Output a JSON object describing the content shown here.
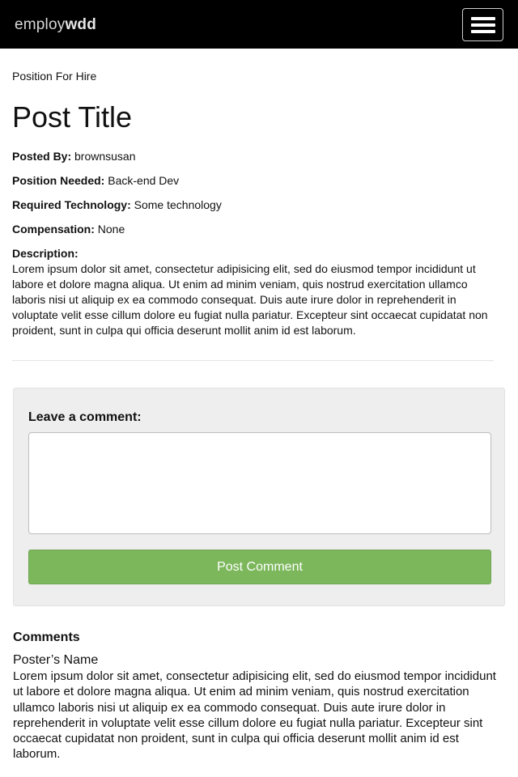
{
  "navbar": {
    "brand_light": "employ",
    "brand_bold": "wdd",
    "menu_icon": "hamburger-menu-icon"
  },
  "post": {
    "category": "Position For Hire",
    "title": "Post Title",
    "fields": [
      {
        "label": "Posted By:",
        "value": "brownsusan"
      },
      {
        "label": "Position Needed:",
        "value": "Back-end Dev"
      },
      {
        "label": "Required Technology:",
        "value": "Some technology"
      },
      {
        "label": "Compensation:",
        "value": "None"
      }
    ],
    "description_label": "Description:",
    "description": "Lorem ipsum dolor sit amet, consectetur adipisicing elit, sed do eiusmod tempor incididunt ut labore et dolore magna aliqua. Ut enim ad minim veniam, quis nostrud exercitation ullamco laboris nisi ut aliquip ex ea commodo consequat. Duis aute irure dolor in reprehenderit in voluptate velit esse cillum dolore eu fugiat nulla pariatur. Excepteur sint occaecat cupidatat non proident, sunt in culpa qui officia deserunt mollit anim id est laborum."
  },
  "comment_form": {
    "label": "Leave a comment:",
    "value": "",
    "submit_label": "Post Comment"
  },
  "comments": {
    "heading": "Comments",
    "items": [
      {
        "author": "Poster’s Name",
        "body": "Lorem ipsum dolor sit amet, consectetur adipisicing elit, sed do eiusmod tempor incididunt ut labore et dolore magna aliqua. Ut enim ad minim veniam, quis nostrud exercitation ullamco laboris nisi ut aliquip ex ea commodo consequat. Duis aute irure dolor in reprehenderit in voluptate velit esse cillum dolore eu fugiat nulla pariatur. Excepteur sint occaecat cupidatat non proident, sunt in culpa qui officia deserunt mollit anim id est laborum."
      }
    ]
  },
  "colors": {
    "navbar_bg": "#000000",
    "panel_bg": "#eeeeee",
    "button_green": "#7cb75c",
    "text": "#111111"
  }
}
